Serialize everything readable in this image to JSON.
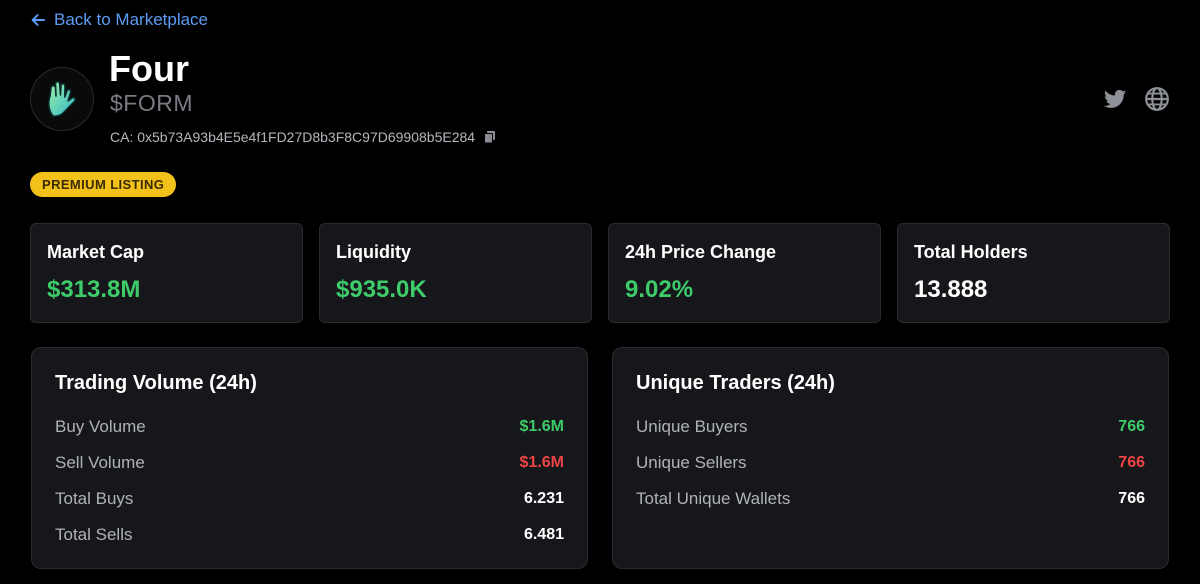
{
  "nav": {
    "back_label": "Back to Marketplace"
  },
  "token": {
    "name": "Four",
    "symbol": "$FORM",
    "ca_label": "CA: 0x5b73A93b4E5e4f1FD27D8b3F8C97D69908b5E284"
  },
  "badge": {
    "label": "PREMIUM LISTING"
  },
  "stats": [
    {
      "label": "Market Cap",
      "value": "$313.8M"
    },
    {
      "label": "Liquidity",
      "value": "$935.0K"
    },
    {
      "label": "24h Price Change",
      "value": "9.02%"
    },
    {
      "label": "Total Holders",
      "value": "13.888"
    }
  ],
  "trading_volume": {
    "title": "Trading Volume (24h)",
    "rows": [
      {
        "label": "Buy Volume",
        "value": "$1.6M"
      },
      {
        "label": "Sell Volume",
        "value": "$1.6M"
      },
      {
        "label": "Total Buys",
        "value": "6.231"
      },
      {
        "label": "Total Sells",
        "value": "6.481"
      }
    ]
  },
  "unique_traders": {
    "title": "Unique Traders (24h)",
    "rows": [
      {
        "label": "Unique Buyers",
        "value": "766"
      },
      {
        "label": "Unique Sellers",
        "value": "766"
      },
      {
        "label": "Total Unique Wallets",
        "value": "766"
      }
    ]
  },
  "colors": {
    "accent_link": "#5b9cf5",
    "positive": "#3ecb6a",
    "negative": "#ef4444",
    "badge": "#f3c21a"
  },
  "icons": [
    "arrow-left-icon",
    "hand-logo-icon",
    "copy-icon",
    "twitter-icon",
    "globe-icon"
  ]
}
